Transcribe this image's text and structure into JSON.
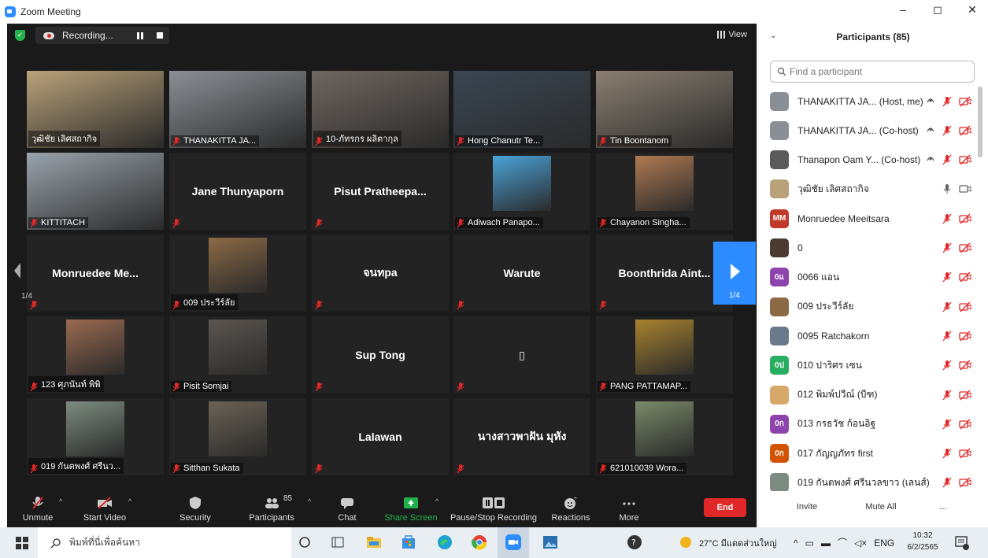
{
  "window": {
    "title": "Zoom Meeting",
    "controls": [
      "–",
      "◻",
      "✕"
    ]
  },
  "meeting_topbar": {
    "recording_label": "Recording...",
    "view_label": "View"
  },
  "gallery": {
    "page_indicator": "1/4",
    "tiles": [
      {
        "name": "วุฒิชัย เลิศสถากิจ",
        "video": true,
        "active": true,
        "muted": false,
        "bg": "#b9a27a"
      },
      {
        "name": "THANAKITTA  JA...",
        "video": true,
        "muted": true,
        "bg": "#8b8f95"
      },
      {
        "name": "10-ภัทรกร ผลิตากุล",
        "video": true,
        "muted": true,
        "bg": "#6f6660"
      },
      {
        "name": "Hong Chanutr Te...",
        "video": true,
        "muted": true,
        "bg": "#3a4652"
      },
      {
        "name": "Tin Boontanom",
        "video": true,
        "muted": true,
        "bg": "#8a7f72"
      },
      {
        "name": "KITTITACH",
        "video": true,
        "muted": true,
        "bg": "#9aa3ab"
      },
      {
        "name": "Jane Thunyaporn",
        "video": false,
        "muted": true
      },
      {
        "name": "Pisut  Pratheepa...",
        "video": false,
        "muted": true
      },
      {
        "name": "Adiwach Panapo...",
        "video": true,
        "small": true,
        "muted": true,
        "bg": "#4aa3d8"
      },
      {
        "name": "Chayanon Singha...",
        "video": true,
        "small": true,
        "muted": true,
        "bg": "#b07a52"
      },
      {
        "name": "Monruedee  Me...",
        "video": false,
        "muted": true
      },
      {
        "name": "009 ประวีร์ลัย",
        "video": true,
        "small": true,
        "muted": true,
        "bg": "#8b6a45"
      },
      {
        "name": "จนทpa",
        "video": false,
        "muted": true
      },
      {
        "name": "Warute",
        "video": false,
        "muted": true
      },
      {
        "name": "Boonthrida  Aint...",
        "video": false,
        "muted": true
      },
      {
        "name": "123 ศุภนันท์ พิพิ",
        "video": true,
        "small": true,
        "muted": true,
        "bg": "#9a6a50"
      },
      {
        "name": "Pisit Somjai",
        "video": true,
        "small": true,
        "muted": true,
        "bg": "#5b5550"
      },
      {
        "name": "Sup Tong",
        "video": false,
        "muted": true
      },
      {
        "name": "▯",
        "video": false,
        "muted": true
      },
      {
        "name": "PANG PATTAMAP...",
        "video": true,
        "small": true,
        "muted": true,
        "bg": "#a8832e"
      },
      {
        "name": "019 กันตพงศ์ ศรีนว...",
        "video": true,
        "small": true,
        "muted": true,
        "bg": "#7d8c80"
      },
      {
        "name": "Sitthan Sukata",
        "video": true,
        "small": true,
        "muted": true,
        "bg": "#6b6255"
      },
      {
        "name": "Lalawan",
        "video": false,
        "muted": true
      },
      {
        "name": "นางสาวพาฝัน มุหัง",
        "video": false,
        "muted": true
      },
      {
        "name": "621010039 Wora...",
        "video": true,
        "small": true,
        "muted": true,
        "bg": "#7a8a6a"
      }
    ]
  },
  "toolbar": {
    "unmute": "Unmute",
    "start_video": "Start Video",
    "security": "Security",
    "participants": "Participants",
    "participants_count": "85",
    "chat": "Chat",
    "share_screen": "Share Screen",
    "pause_recording": "Pause/Stop Recording",
    "reactions": "Reactions",
    "more": "More",
    "end": "End"
  },
  "participants_panel": {
    "title": "Participants (85)",
    "search_placeholder": "Find a participant",
    "rows": [
      {
        "name": "THANAKITTA  JA...  (Host, me)",
        "avatar_text": "",
        "avatar_color": "#8a8f96",
        "mic": "off",
        "cam": "off",
        "share_icon": true
      },
      {
        "name": "THANAKITTA  JA...  (Co-host)",
        "avatar_text": "",
        "avatar_color": "#8a8f96",
        "mic": "off",
        "cam": "off",
        "share_icon": true
      },
      {
        "name": "Thanapon Oam Y...  (Co-host)",
        "avatar_text": "",
        "avatar_color": "#5a5a5a",
        "mic": "off",
        "cam": "off",
        "share_icon": true
      },
      {
        "name": "วุฒิชัย เลิศสถากิจ",
        "avatar_text": "",
        "avatar_color": "#b9a27a",
        "mic": "on",
        "cam": "on"
      },
      {
        "name": "Monruedee Meeitsara",
        "avatar_text": "MM",
        "avatar_color": "#c0392b",
        "mic": "off",
        "cam": "off"
      },
      {
        "name": "0",
        "avatar_text": "",
        "avatar_color": "#4a3a30",
        "mic": "off",
        "cam": "off"
      },
      {
        "name": "0066 แอน",
        "avatar_text": "0แ",
        "avatar_color": "#8e44ad",
        "mic": "off",
        "cam": "off"
      },
      {
        "name": "009 ประวีร์ลัย",
        "avatar_text": "",
        "avatar_color": "#8b6a45",
        "mic": "off",
        "cam": "off"
      },
      {
        "name": "0095 Ratchakorn",
        "avatar_text": "",
        "avatar_color": "#6a7a8a",
        "mic": "off",
        "cam": "off"
      },
      {
        "name": "010 ปาริศร เซน",
        "avatar_text": "0ป",
        "avatar_color": "#27ae60",
        "mic": "off",
        "cam": "off"
      },
      {
        "name": "012 พิมพ์ปวีณ์ (บีฑ)",
        "avatar_text": "",
        "avatar_color": "#d8a86a",
        "mic": "off",
        "cam": "off"
      },
      {
        "name": "013 กรธวัช ก้อนอิฐ",
        "avatar_text": "0ก",
        "avatar_color": "#8e44ad",
        "mic": "off",
        "cam": "off"
      },
      {
        "name": "017 กัญญภัทร first",
        "avatar_text": "0ก",
        "avatar_color": "#d35400",
        "mic": "off",
        "cam": "off"
      },
      {
        "name": "019 กันตพงศ์ ศรีนวลขาว (เลนส์)",
        "avatar_text": "",
        "avatar_color": "#7d8c80",
        "mic": "off",
        "cam": "off"
      }
    ],
    "invite": "Invite",
    "mute_all": "Mute All",
    "more": "..."
  },
  "taskbar": {
    "search_placeholder": "พิมพ์ที่นี่เพื่อค้นหา",
    "weather": "27°C  มีแดดส่วนใหญ่",
    "language": "ENG",
    "time": "10:32",
    "date": "6/2/2565"
  },
  "colors": {
    "meeting_bg": "#1a1a1a",
    "tile_bg": "#232323",
    "active_border": "#d3d84a",
    "accent_blue": "#2d8cff",
    "end_red": "#e02828",
    "share_green": "#22b24c",
    "muted_red": "#e02828"
  }
}
